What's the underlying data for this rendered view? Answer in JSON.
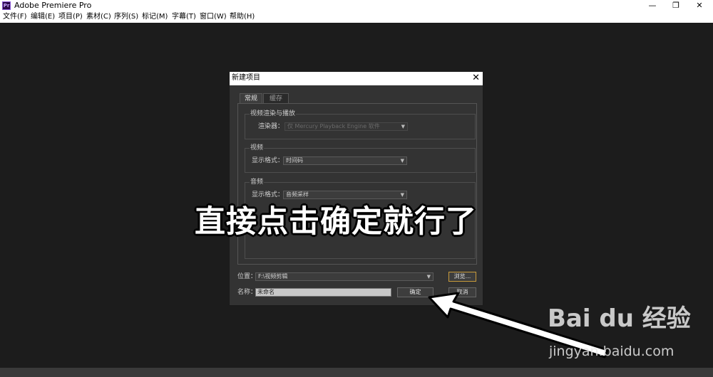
{
  "window": {
    "title": "Adobe Premiere Pro",
    "icon_label": "Pr",
    "minimize_icon": "—",
    "maximize_icon": "❐",
    "close_icon": "✕"
  },
  "menu": [
    "文件(F)",
    "编辑(E)",
    "项目(P)",
    "素材(C)",
    "序列(S)",
    "标记(M)",
    "字幕(T)",
    "窗口(W)",
    "帮助(H)"
  ],
  "dialog": {
    "title": "新建项目",
    "close_icon": "✕",
    "tabs": [
      "常规",
      "缓存"
    ],
    "video_render_group": {
      "title": "视频渲染与播放",
      "renderer_label": "渲染器：",
      "renderer_value": "仅 Mercury Playback Engine 软件"
    },
    "video_group": {
      "title": "视频",
      "format_label": "显示格式：",
      "format_value": "时间码"
    },
    "audio_group": {
      "title": "音频",
      "format_label": "显示格式：",
      "format_value": "音频采样"
    },
    "location_label": "位置：",
    "location_value": "F:\\视频剪辑",
    "browse_label": "浏览...",
    "name_label": "名称：",
    "name_value": "未命名",
    "ok_label": "确定",
    "cancel_label": "取消"
  },
  "overlay": {
    "caption": "直接点击确定就行了"
  },
  "watermark": {
    "logo": "Bai du 经验",
    "url": "jingyan.baidu.com"
  },
  "colors": {
    "workspace": "#1c1c1c",
    "dialog_bg": "#333333",
    "focus_border": "#c89a3a"
  }
}
